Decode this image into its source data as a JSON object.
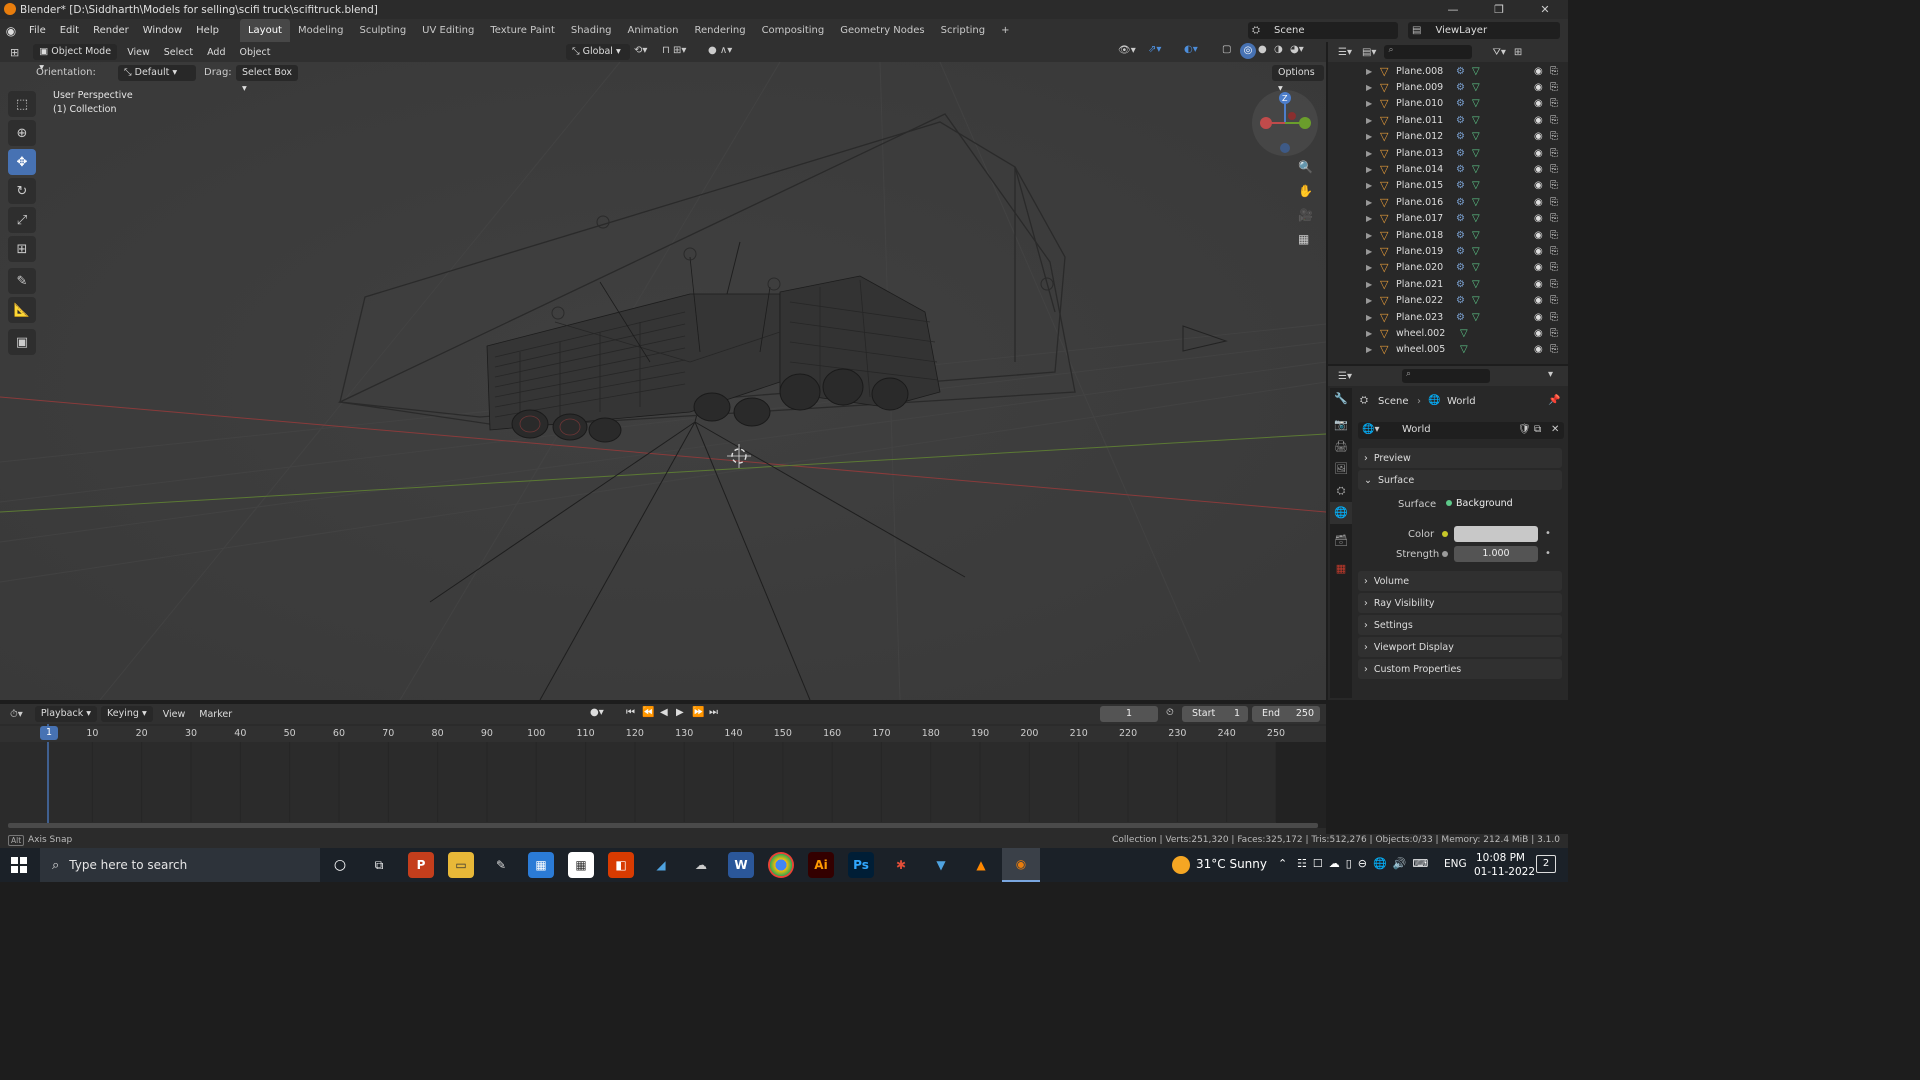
{
  "window": {
    "title": "Blender* [D:\\Siddharth\\Models for selling\\scifi truck\\scifitruck.blend]",
    "controls": [
      "—",
      "❐",
      "✕"
    ]
  },
  "menu": {
    "items": [
      "File",
      "Edit",
      "Render",
      "Window",
      "Help"
    ],
    "workspaces": [
      "Layout",
      "Modeling",
      "Sculpting",
      "UV Editing",
      "Texture Paint",
      "Shading",
      "Animation",
      "Rendering",
      "Compositing",
      "Geometry Nodes",
      "Scripting"
    ],
    "active_workspace": "Layout",
    "add_tab": "+",
    "scene": "Scene",
    "view_layer": "ViewLayer"
  },
  "viewport_header": {
    "mode": "Object Mode",
    "menus": [
      "View",
      "Select",
      "Add",
      "Object"
    ],
    "transform": "Global",
    "orientation_label": "Orientation:",
    "orientation_value": "Default",
    "drag_label": "Drag:",
    "drag_value": "Select Box",
    "options": "Options"
  },
  "viewport": {
    "perspective": "User Perspective",
    "collection": "(1) Collection",
    "gizmo_axes": [
      "Z",
      "Y",
      "X"
    ]
  },
  "outliner": {
    "items": [
      "Plane.008",
      "Plane.009",
      "Plane.010",
      "Plane.011",
      "Plane.012",
      "Plane.013",
      "Plane.014",
      "Plane.015",
      "Plane.016",
      "Plane.017",
      "Plane.018",
      "Plane.019",
      "Plane.020",
      "Plane.021",
      "Plane.022",
      "Plane.023",
      "wheel.002",
      "wheel.005"
    ]
  },
  "properties": {
    "breadcrumb_scene": "Scene",
    "breadcrumb_world": "World",
    "world_name": "World",
    "panels": {
      "preview": "Preview",
      "surface": "Surface",
      "volume": "Volume",
      "ray_visibility": "Ray Visibility",
      "settings": "Settings",
      "viewport_display": "Viewport Display",
      "custom_properties": "Custom Properties"
    },
    "surface_label": "Surface",
    "surface_value": "Background",
    "color_label": "Color",
    "strength_label": "Strength",
    "strength_value": "1.000",
    "color_swatch": "#c8c8c8"
  },
  "timeline": {
    "menus": [
      "Playback",
      "Keying",
      "View",
      "Marker"
    ],
    "current_frame": "1",
    "start_label": "Start",
    "start_value": "1",
    "end_label": "End",
    "end_value": "250",
    "ticks": [
      "1",
      "10",
      "20",
      "30",
      "40",
      "50",
      "60",
      "70",
      "80",
      "90",
      "100",
      "110",
      "120",
      "130",
      "140",
      "150",
      "160",
      "170",
      "180",
      "190",
      "200",
      "210",
      "220",
      "230",
      "240",
      "250"
    ]
  },
  "statusbar": {
    "left": "Axis Snap",
    "alt_key": "Alt",
    "stats": "Collection | Verts:251,320 | Faces:325,172 | Tris:512,276 | Objects:0/33 | Memory: 212.4 MiB | 3.1.0"
  },
  "taskbar": {
    "search_placeholder": "Type here to search",
    "weather": "31°C  Sunny",
    "language": "ENG",
    "time": "10:08 PM",
    "date": "01-11-2022",
    "notification_count": "2",
    "apps": [
      "P",
      "Ai",
      "Ps"
    ]
  },
  "colors": {
    "accent": "#4772b3",
    "orange_object": "#e59b3a",
    "mesh_green": "#5ec98a",
    "playhead": "#4772b3"
  }
}
